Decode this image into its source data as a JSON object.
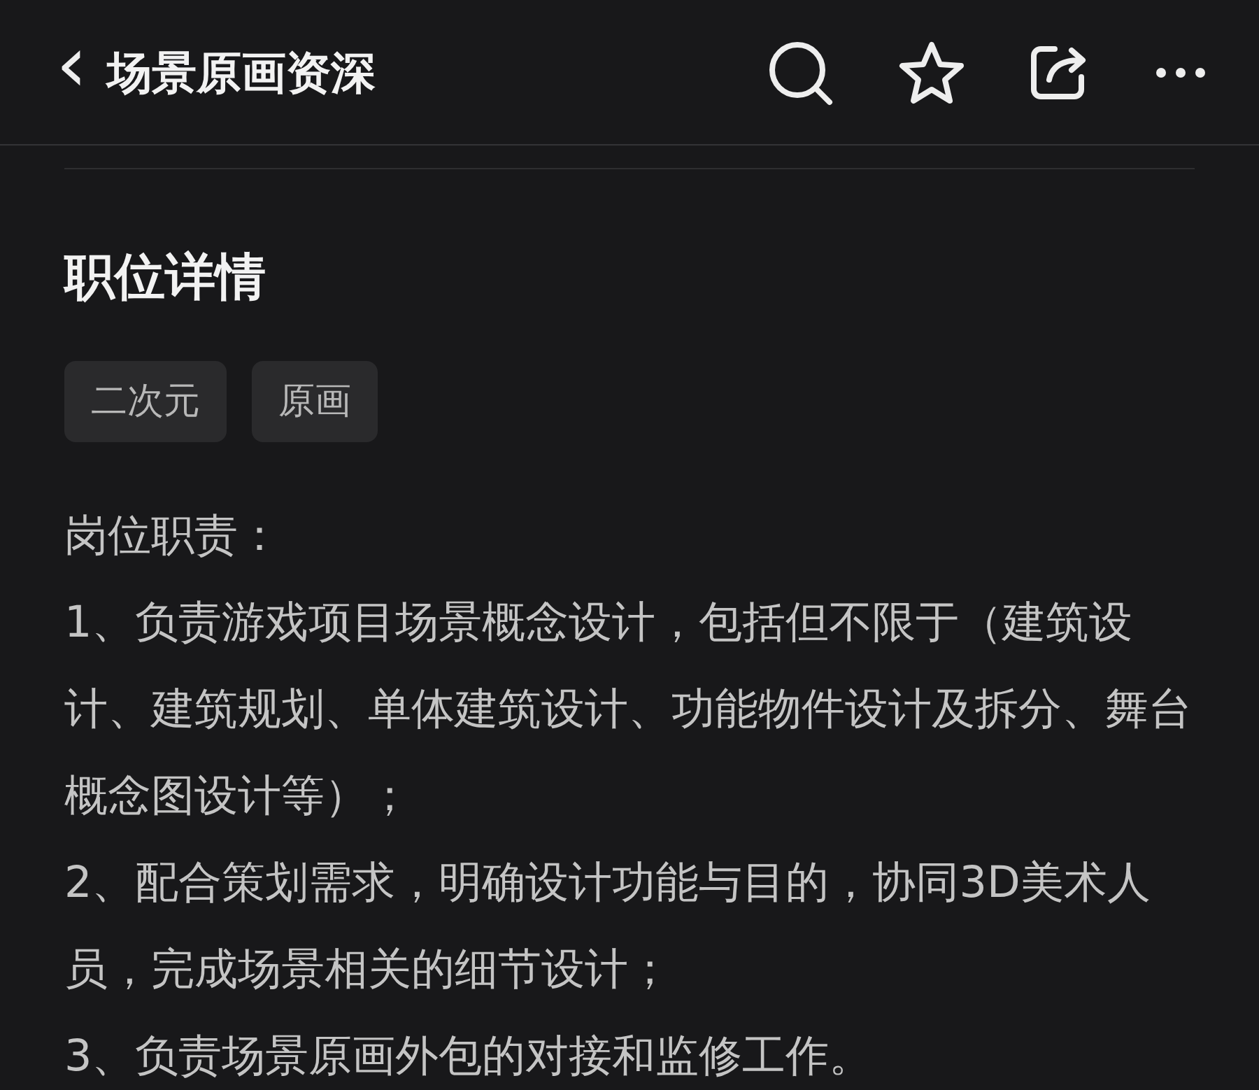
{
  "header": {
    "back": "‹",
    "title": "场景原画资深"
  },
  "section": {
    "title": "职位详情"
  },
  "tags": [
    "二次元",
    "原画"
  ],
  "paragraphs": [
    "岗位职责：",
    "1、负责游戏项目场景概念设计，包括但不限于（建筑设计、建筑规划、单体建筑设计、功能物件设计及拆分、舞台概念图设计等）；",
    "2、配合策划需求，明确设计功能与目的，协同3D美术人员，完成场景相关的细节设计；",
    "3、负责场景原画外包的对接和监修工作。"
  ]
}
